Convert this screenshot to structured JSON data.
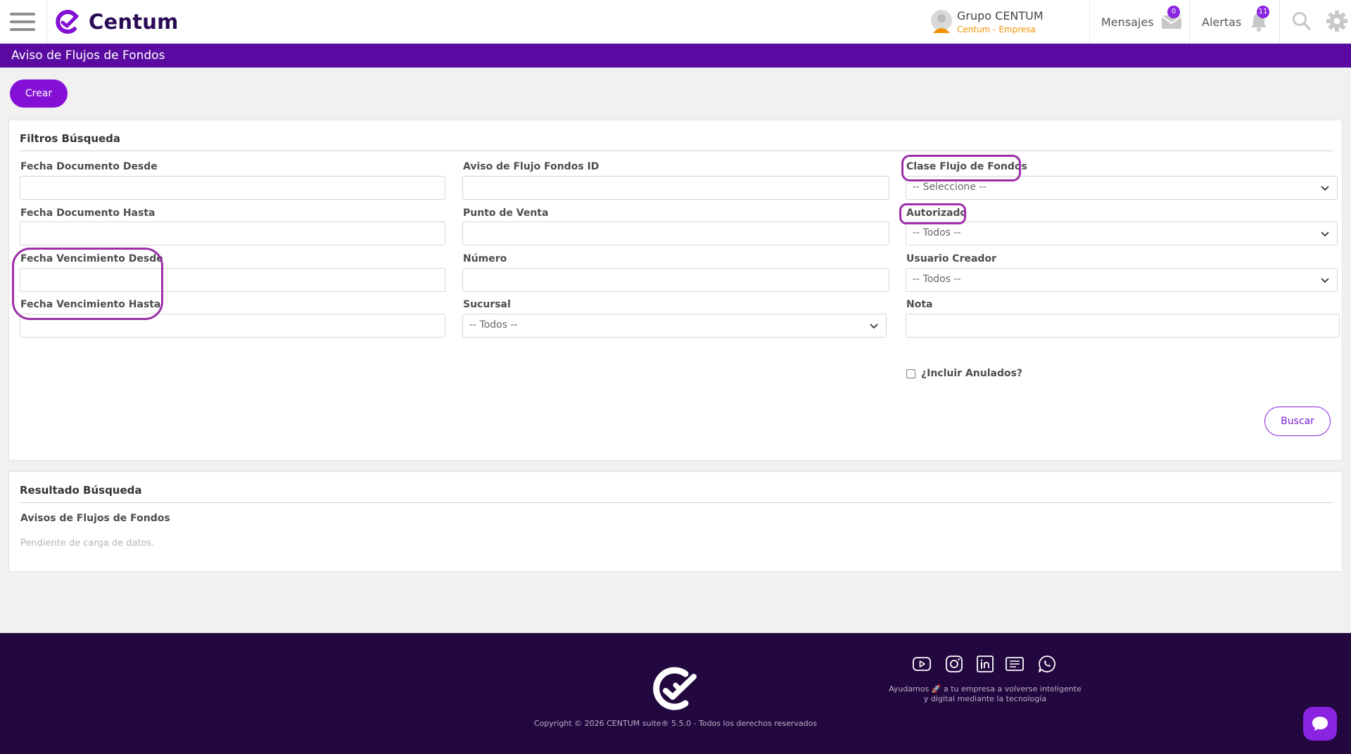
{
  "header": {
    "logo_text": "Centum",
    "user_name": "Grupo CENTUM",
    "user_company": "Centum - Empresa",
    "messages_label": "Mensajes",
    "messages_count": "0",
    "alerts_label": "Alertas",
    "alerts_count": "11"
  },
  "page": {
    "title": "Aviso de Flujos de Fondos",
    "create_label": "Crear"
  },
  "filters": {
    "title": "Filtros Búsqueda",
    "fecha_doc_desde": "Fecha Documento Desde",
    "fecha_doc_hasta": "Fecha Documento Hasta",
    "fecha_venc_desde": "Fecha Vencimiento Desde",
    "fecha_venc_hasta": "Fecha Vencimiento Hasta",
    "aviso_id": "Aviso de Flujo Fondos ID",
    "punto_venta": "Punto de Venta",
    "numero": "Número",
    "sucursal": "Sucursal",
    "sucursal_value": "-- Todos --",
    "clase_flujo": "Clase Flujo de Fondos",
    "clase_flujo_value": "-- Seleccione --",
    "autorizado": "Autorizado",
    "autorizado_value": "-- Todos --",
    "usuario_creador": "Usuario Creador",
    "usuario_creador_value": "-- Todos --",
    "nota": "Nota",
    "incluir_anulados": "¿Incluir Anulados?",
    "search_label": "Buscar"
  },
  "results": {
    "title": "Resultado Búsqueda",
    "subtitle": "Avisos de Flujos de Fondos",
    "empty_text": "Pendiente de carga de datos."
  },
  "footer": {
    "tagline_part1": "Ayudamos",
    "tagline_rocket": "🚀",
    "tagline_part2": "a tu empresa a volverse inteligente",
    "tagline_line2": "y digital mediante la tecnología",
    "copyright": "Copyright © 2026 CENTUM suite® 5.5.0 - Todos los derechos reservados",
    "social_icons": [
      "youtube-icon",
      "instagram-icon",
      "linkedin-icon",
      "news-icon",
      "whatsapp-icon"
    ]
  },
  "colors": {
    "brand_purple": "#5a0aa0",
    "accent_purple": "#8410d6",
    "footer_bg": "#23083f",
    "highlight": "#9b2fa8",
    "company_orange": "#f39200"
  }
}
